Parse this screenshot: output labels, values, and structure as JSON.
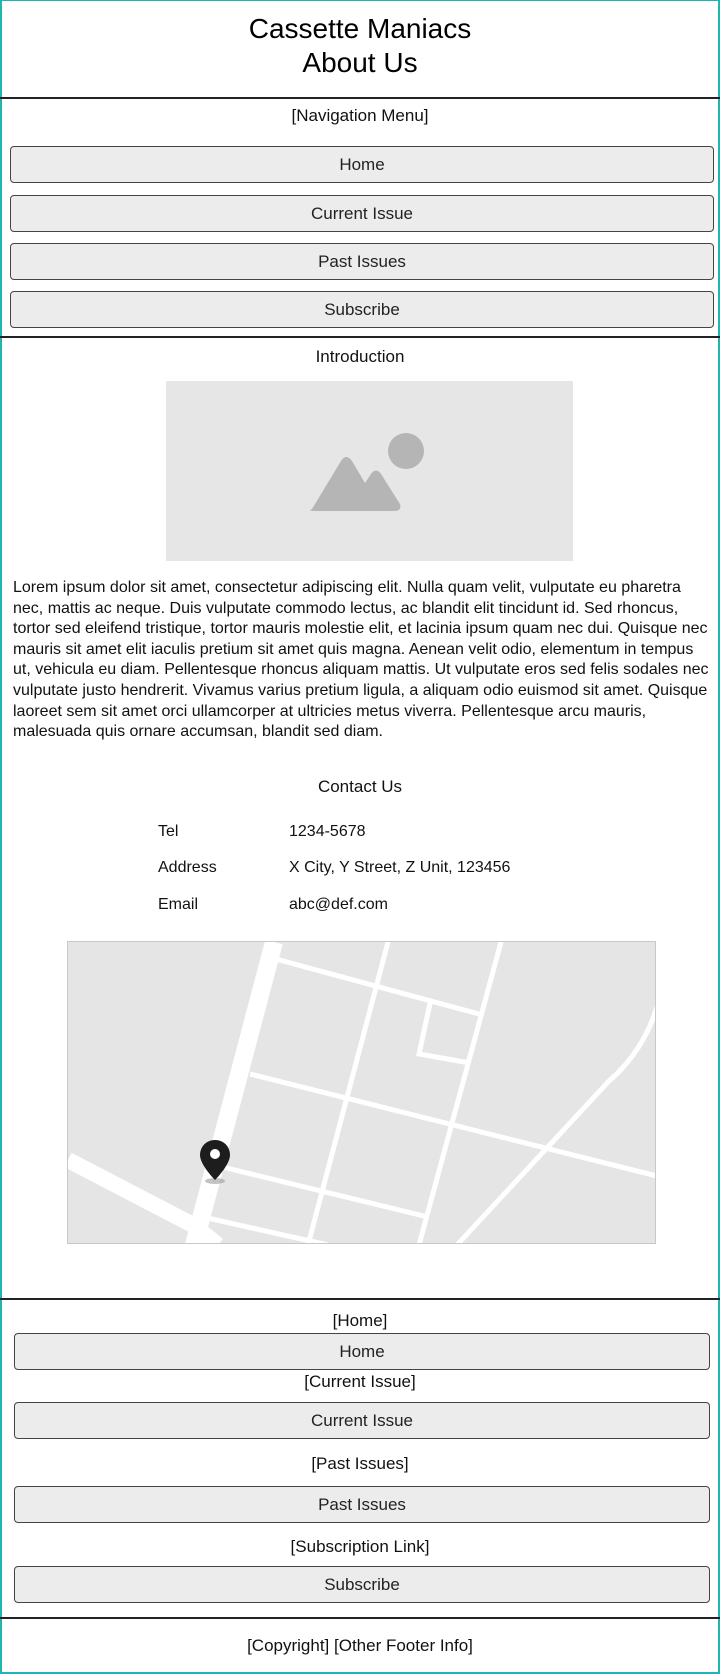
{
  "header": {
    "site_name": "Cassette Maniacs",
    "page_title": "About Us"
  },
  "nav": {
    "label": "[Navigation Menu]",
    "items": [
      {
        "label": "Home"
      },
      {
        "label": "Current Issue"
      },
      {
        "label": "Past Issues"
      },
      {
        "label": "Subscribe"
      }
    ]
  },
  "intro": {
    "title": "Introduction",
    "image_icon": "image-placeholder-icon",
    "body": "Lorem ipsum dolor sit amet, consectetur adipiscing elit. Nulla quam velit, vulputate eu pharetra nec, mattis ac neque. Duis vulputate commodo lectus, ac blandit elit tincidunt id. Sed rhoncus, tortor sed eleifend tristique, tortor mauris molestie elit, et lacinia ipsum quam nec dui. Quisque nec mauris sit amet elit iaculis pretium sit amet quis magna. Aenean velit odio, elementum in tempus ut, vehicula eu diam. Pellentesque rhoncus aliquam mattis. Ut vulputate eros sed felis sodales nec vulputate justo hendrerit. Vivamus varius pretium ligula, a aliquam odio euismod sit amet. Quisque laoreet sem sit amet orci ullamcorper at ultricies metus viverra. Pellentesque arcu mauris, malesuada quis ornare accumsan, blandit sed diam."
  },
  "contact": {
    "title": "Contact Us",
    "rows": [
      {
        "key": "Tel",
        "value": "1234-5678"
      },
      {
        "key": "Address",
        "value": "X City, Y Street, Z Unit, 123456"
      },
      {
        "key": "Email",
        "value": "abc@def.com"
      }
    ],
    "map_icon": "map-pin-icon"
  },
  "footer_nav": {
    "home_label": "[Home]",
    "home_button": "Home",
    "current_label": "[Current Issue]",
    "current_button": "Current Issue",
    "past_label": "[Past Issues]",
    "past_button": "Past Issues",
    "subscribe_label": "[Subscription Link]",
    "subscribe_button": "Subscribe"
  },
  "footer": {
    "copyright": "[Copyright] [Other Footer Info]"
  },
  "colors": {
    "frame": "#1fb5b0",
    "button_bg": "#ececec",
    "placeholder_bg": "#e6e6e6",
    "placeholder_icon": "#b5b5b5"
  }
}
